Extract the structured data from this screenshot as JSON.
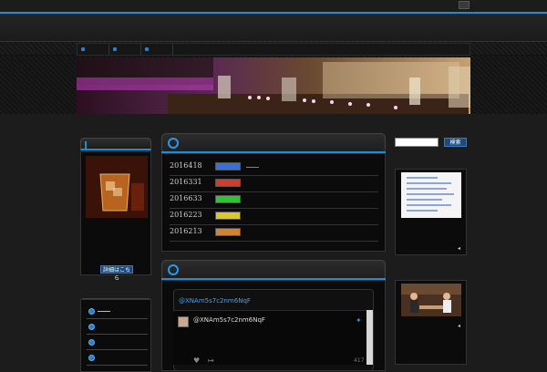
{
  "colors": {
    "accent": "#1a8fd8"
  },
  "search": {
    "placeholder": "",
    "button_label": "検索"
  },
  "center": {
    "rows": [
      {
        "year": "2016418",
        "color": "#3a6fd8"
      },
      {
        "year": "2016331",
        "color": "#d83a2a"
      },
      {
        "year": "2016633",
        "color": "#2ac82a"
      },
      {
        "year": "2016223",
        "color": "#d8c82a"
      },
      {
        "year": "2016213",
        "color": "#d8802a"
      }
    ]
  },
  "twitter": {
    "header_handle": "@XNAm5s7c2nm6NqF",
    "tweet_handle": "@XNAm5s7c2nm6NqF",
    "count": "417"
  },
  "left": {
    "image_button_label": "詳細はこちら"
  }
}
